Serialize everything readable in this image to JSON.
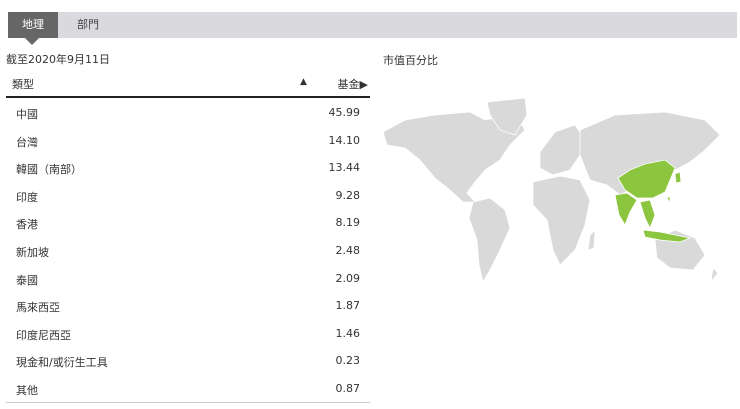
{
  "tabs": [
    {
      "label": "地理",
      "active": true
    },
    {
      "label": "部門",
      "active": false
    }
  ],
  "as_of": "截至2020年9月11日",
  "map_title": "市值百分比",
  "table": {
    "col_type": "類型",
    "sort_icon": "▲",
    "col_fund": "基金▶",
    "rows": [
      {
        "name": "中國",
        "value": "45.99"
      },
      {
        "name": "台灣",
        "value": "14.10"
      },
      {
        "name": "韓國（南部）",
        "value": "13.44"
      },
      {
        "name": "印度",
        "value": "9.28"
      },
      {
        "name": "香港",
        "value": "8.19"
      },
      {
        "name": "新加坡",
        "value": "2.48"
      },
      {
        "name": "泰國",
        "value": "2.09"
      },
      {
        "name": "馬來西亞",
        "value": "1.87"
      },
      {
        "name": "印度尼西亞",
        "value": "1.46"
      },
      {
        "name": "現金和/或衍生工具",
        "value": "0.23"
      },
      {
        "name": "其他",
        "value": "0.87"
      }
    ]
  },
  "colors": {
    "highlight": "#8cc63f",
    "land": "#d9d9d9"
  }
}
